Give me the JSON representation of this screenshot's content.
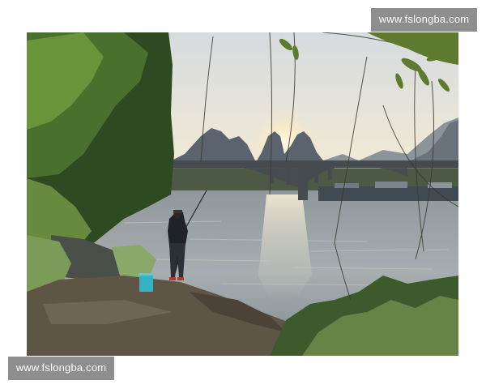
{
  "watermarks": {
    "top_right": "www.fslongba.com",
    "bottom_left": "www.fslongba.com"
  },
  "colors": {
    "sky_top": "#d9dde0",
    "sky_horizon": "#f3ead2",
    "sun": "#fff6d8",
    "mountain": "#5d6670",
    "mountain_far": "#8a929a",
    "bridge": "#4a4f55",
    "river": "#9aa3a8",
    "river_shine": "#e8e3cf",
    "foliage_dark": "#2f4a24",
    "foliage_light": "#6e9440",
    "ground": "#5d5445",
    "bucket": "#3ab5c0"
  }
}
